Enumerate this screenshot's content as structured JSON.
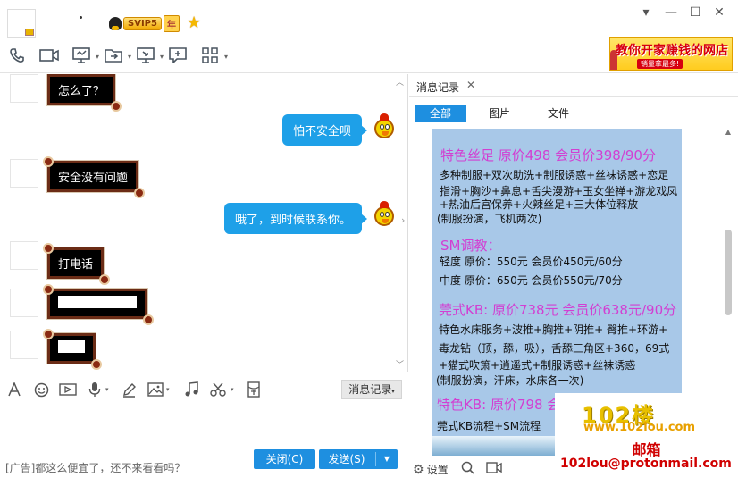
{
  "header": {
    "vip_badge": "SVIP5",
    "vip_year": "年",
    "ad_banner": {
      "headline": "教你开家赚钱的网店",
      "subline": "销量拿最多!"
    }
  },
  "window_controls": {
    "dropdown": "▾",
    "minimize": "—",
    "maximize": "☐",
    "close": "✕"
  },
  "toolbar": {
    "icons": [
      "phone-icon",
      "video-icon",
      "screen-share-icon",
      "file-transfer-icon",
      "remote-desktop-icon",
      "whiteboard-icon",
      "apps-icon"
    ]
  },
  "chat": {
    "messages": [
      {
        "side": "left",
        "text": "怎么了？"
      },
      {
        "side": "right",
        "text": "怕不安全呗"
      },
      {
        "side": "left",
        "text": "安全没有问题"
      },
      {
        "side": "right",
        "text": "哦了，到时候联系你。"
      },
      {
        "side": "left",
        "text": "打电话"
      },
      {
        "side": "left",
        "text": ""
      },
      {
        "side": "left",
        "text": ""
      }
    ]
  },
  "input_toolbar": {
    "history_button": "消息记录"
  },
  "footer": {
    "ad_text": "[广告]都这么便宜了，还不来看看吗？",
    "close_label": "关闭(C)",
    "send_label": "发送(S)"
  },
  "right_panel": {
    "tab_label": "消息记录",
    "filters": [
      "全部",
      "图片",
      "文件"
    ],
    "active_filter": "全部",
    "settings_label": "设置"
  },
  "poster": {
    "sections": [
      {
        "title": "特色丝足  原价498 会员价398/90分",
        "lines": [
          "多种制服+双次助洗+制服诱惑+丝袜诱惑+恋足",
          "指滑+胸沙+鼻息+舌尖漫游+玉女坐禅+游龙戏凤",
          "+热油后宫保养+火辣丝足+三大体位释放",
          "(制服扮演，飞机两次)"
        ]
      },
      {
        "title": "SM调教：",
        "lines": [
          "轻度 原价：550元 会员价450元/60分",
          "中度 原价：650元 会员价550元/70分"
        ]
      },
      {
        "title": "莞式KB: 原价738元 会员价638元/90分",
        "lines": [
          "特色水床服务+波推+胸推+阴推+ 臀推+环游+",
          "毒龙钻（顶，舔，吸），舌舔三角区+360，69式",
          "+猫式吹箫+逍遥式+制服诱惑+丝袜诱惑",
          "(制服扮演，汗床，水床各一次)"
        ]
      },
      {
        "title": "特色KB:  原价798  会",
        "lines": [
          "莞式KB流程+SM流程"
        ]
      }
    ]
  },
  "watermark": {
    "logo": "102楼",
    "url": "www.102lou.com",
    "mail_label": "邮箱",
    "mail_address": "102lou@protonmail.com"
  },
  "colors": {
    "accent_blue": "#1e8fe0",
    "bubble_blue": "#1ea0e8",
    "poster_bg": "#a8c8e8",
    "poster_title": "#d23fd2",
    "watermark_red": "#d00000"
  }
}
